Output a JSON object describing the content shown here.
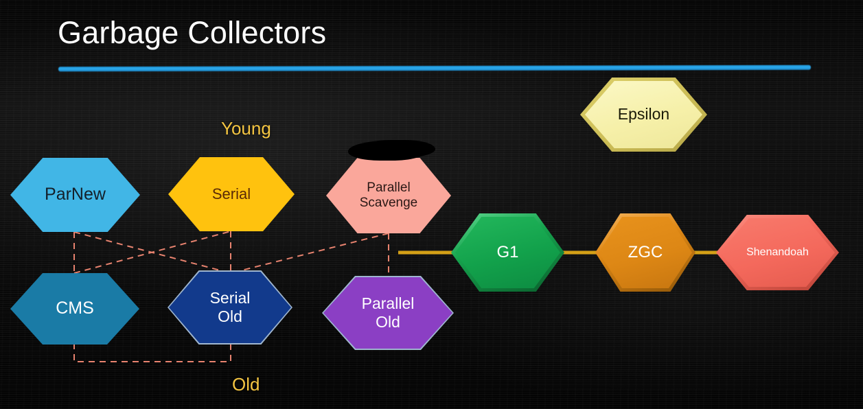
{
  "slide": {
    "title": "Garbage Collectors",
    "background": "#0a0a0a",
    "accent_rule_color": "#2cabee",
    "title_color": "#ffffff"
  },
  "generation_labels": [
    {
      "id": "young",
      "text": "Young",
      "color": "#f4c542"
    },
    {
      "id": "old",
      "text": "Old",
      "color": "#f4c542"
    }
  ],
  "collectors": [
    {
      "id": "parnew",
      "label": "ParNew",
      "generation": "Young",
      "fill": "#41b6e6",
      "text_color": "#14202b",
      "border": "#2f3f4d",
      "style": "flat"
    },
    {
      "id": "serial",
      "label": "Serial",
      "generation": "Young",
      "fill": "#ffc20e",
      "text_color": "#5a2a06",
      "border": "#35541f",
      "style": "flat"
    },
    {
      "id": "parallel-scavenge",
      "label": "Parallel Scavenge",
      "label_lines": [
        "Parallel",
        "Scavenge"
      ],
      "generation": "Young",
      "fill": "#faa79b",
      "text_color": "#2a1815",
      "border": "#3d4a58",
      "style": "flat"
    },
    {
      "id": "cms",
      "label": "CMS",
      "generation": "Old",
      "fill": "#1a7ba6",
      "text_color": "#ffffff",
      "border": "#2f5c72",
      "style": "flat"
    },
    {
      "id": "serial-old",
      "label": "Serial Old",
      "label_lines": [
        "Serial",
        "Old"
      ],
      "generation": "Old",
      "fill": "#123a8c",
      "text_color": "#ffffff",
      "border": "#9fb6cf",
      "style": "flat"
    },
    {
      "id": "parallel-old",
      "label": "Parallel Old",
      "label_lines": [
        "Parallel",
        "Old"
      ],
      "generation": "Old",
      "fill": "#8b3fc4",
      "text_color": "#ffffff",
      "border": "#9fb6cf",
      "style": "flat"
    },
    {
      "id": "g1",
      "label": "G1",
      "generation": "Both",
      "fill": "#16a34e",
      "text_color": "#ffffff",
      "border": "#0c7a39",
      "style": "beveled"
    },
    {
      "id": "zgc",
      "label": "ZGC",
      "generation": "Both",
      "fill": "#dd8715",
      "text_color": "#ffffff",
      "border": "#b06a0c",
      "style": "beveled"
    },
    {
      "id": "shenandoah",
      "label": "Shenandoah",
      "generation": "Both",
      "fill": "#f4695c",
      "text_color": "#ffffff",
      "border": "#c94b40",
      "style": "beveled"
    },
    {
      "id": "epsilon",
      "label": "Epsilon",
      "generation": "None",
      "fill": "#f6f0a9",
      "text_color": "#1b1b08",
      "border": "#cbbc55",
      "style": "beveled"
    }
  ],
  "connections": {
    "dashed_color": "#e8836f",
    "solid_color": "#d4a017",
    "pairs": [
      {
        "from": "parnew",
        "to": "cms",
        "style": "dashed"
      },
      {
        "from": "parnew",
        "to": "serial-old",
        "style": "dashed"
      },
      {
        "from": "serial",
        "to": "serial-old",
        "style": "dashed"
      },
      {
        "from": "cms",
        "to": "serial-old",
        "style": "dashed"
      },
      {
        "from": "parallel-scavenge",
        "to": "serial-old",
        "style": "dashed"
      },
      {
        "from": "parallel-scavenge",
        "to": "parallel-old",
        "style": "dashed"
      },
      {
        "from": "parallel-scavenge",
        "to": "g1",
        "style": "solid"
      },
      {
        "from": "g1",
        "to": "zgc",
        "style": "solid"
      },
      {
        "from": "zgc",
        "to": "shenandoah",
        "style": "solid"
      }
    ]
  },
  "annotations": [
    {
      "id": "redaction",
      "kind": "black-marker-scribble",
      "over": "parallel-scavenge"
    }
  ]
}
